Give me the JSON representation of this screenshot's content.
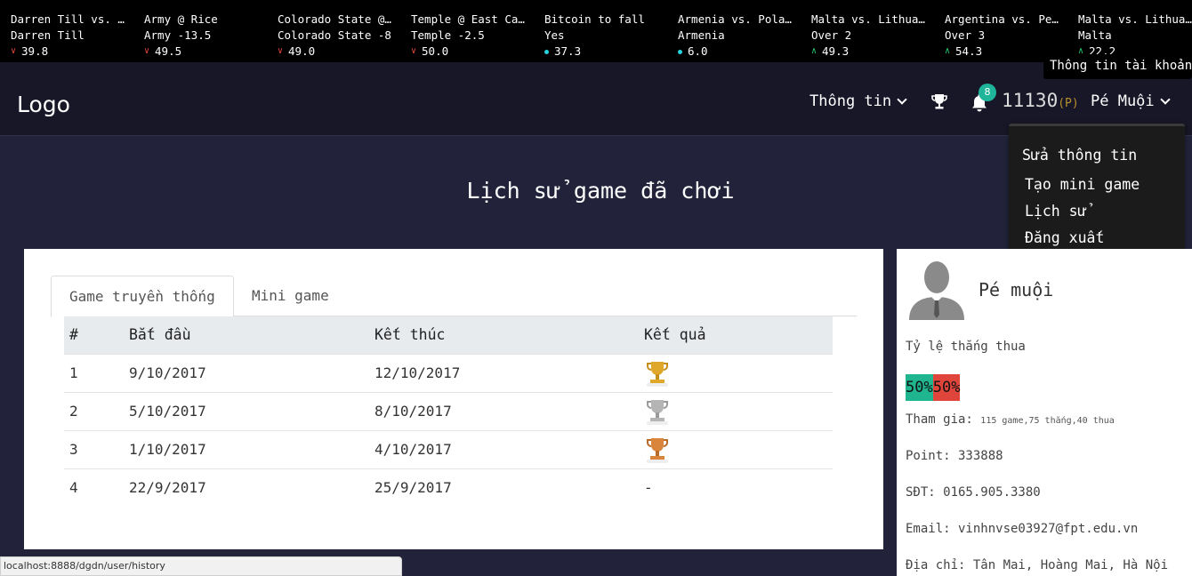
{
  "ticker": [
    {
      "title": "Darren Till vs. …",
      "pick": "Darren Till",
      "trend": "down",
      "value": "39.8"
    },
    {
      "title": "Army @ Rice",
      "pick": "Army -13.5",
      "trend": "down",
      "value": "49.5"
    },
    {
      "title": "Colorado State @…",
      "pick": "Colorado State -8",
      "trend": "down",
      "value": "49.0"
    },
    {
      "title": "Temple @ East Ca…",
      "pick": "Temple -2.5",
      "trend": "down",
      "value": "50.0"
    },
    {
      "title": "Bitcoin to fall",
      "pick": "Yes",
      "trend": "neutral",
      "value": "37.3"
    },
    {
      "title": "Armenia vs. Pola…",
      "pick": "Armenia",
      "trend": "neutral",
      "value": "6.0"
    },
    {
      "title": "Malta vs. Lithua…",
      "pick": "Over 2",
      "trend": "up",
      "value": "49.3"
    },
    {
      "title": "Argentina vs. Pe…",
      "pick": "Over 3",
      "trend": "up",
      "value": "54.3"
    },
    {
      "title": "Malta vs. Lithua…",
      "pick": "Malta",
      "trend": "up",
      "value": "22.2"
    }
  ],
  "nav": {
    "logo": "Logo",
    "info_label": "Thông tin",
    "notification_count": "8",
    "points": "11130",
    "points_unit": "(P)",
    "user_name": "Pé Muội",
    "tooltip": "Thông tin tài khoản"
  },
  "dropdown": {
    "items": [
      "Sửa thông tin",
      "Tạo mini game",
      "Lịch sử",
      "Đăng xuất"
    ]
  },
  "page": {
    "title": "Lịch sử game đã chơi"
  },
  "tabs": [
    {
      "label": "Game truyền thống",
      "active": true
    },
    {
      "label": "Mini game",
      "active": false
    }
  ],
  "table": {
    "headers": [
      "#",
      "Bắt đầu",
      "Kết thúc",
      "Kết quả"
    ],
    "rows": [
      {
        "num": "1",
        "start": "9/10/2017",
        "end": "12/10/2017",
        "result": "gold-trophy"
      },
      {
        "num": "2",
        "start": "5/10/2017",
        "end": "8/10/2017",
        "result": "silver-trophy"
      },
      {
        "num": "3",
        "start": "1/10/2017",
        "end": "4/10/2017",
        "result": "bronze-trophy"
      },
      {
        "num": "4",
        "start": "22/9/2017",
        "end": "25/9/2017",
        "result": "-"
      }
    ]
  },
  "profile": {
    "name": "Pé muội",
    "ratio_label": "Tỷ lệ thắng thua",
    "win_pct": "50%",
    "lose_pct": "50%",
    "join_label": "Tham gia:",
    "join_detail": "115 game,75 thắng,40 thua",
    "point": "Point: 333888",
    "phone": "SĐT: 0165.905.3380",
    "email": "Email: vinhnvse03927@fpt.edu.vn",
    "address": "Địa chỉ: Tân Mai, Hoàng Mai, Hà Nội"
  },
  "status_url": "localhost:8888/dgdn/user/history",
  "colors": {
    "win": "#1fb58f",
    "lose": "#e0453c",
    "badge": "#1fb59a",
    "background": "#22233a"
  }
}
